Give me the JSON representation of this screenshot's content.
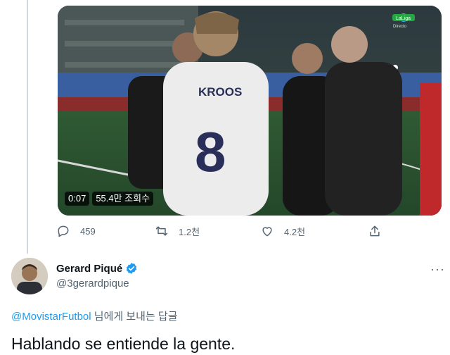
{
  "video": {
    "jersey_name": "KROOS",
    "jersey_number": "8",
    "broadcaster_badge": "LaLiga",
    "broadcaster_sub": "Directo",
    "duration": "0:07",
    "views": "55.4만 조회수"
  },
  "actions": {
    "replies": "459",
    "retweets": "1.2천",
    "likes": "4.2천"
  },
  "reply_tweet": {
    "author_name": "Gerard Piqué",
    "author_handle": "@3gerardpique",
    "more_label": "···",
    "reply_to_mention": "@MovistarFutbol",
    "reply_to_suffix": "님에게 보내는 답글",
    "text": "Hablando se entiende la gente."
  },
  "colors": {
    "accent": "#1d9bf0",
    "secondary_text": "#536471",
    "verified": "#1d9bf0"
  }
}
